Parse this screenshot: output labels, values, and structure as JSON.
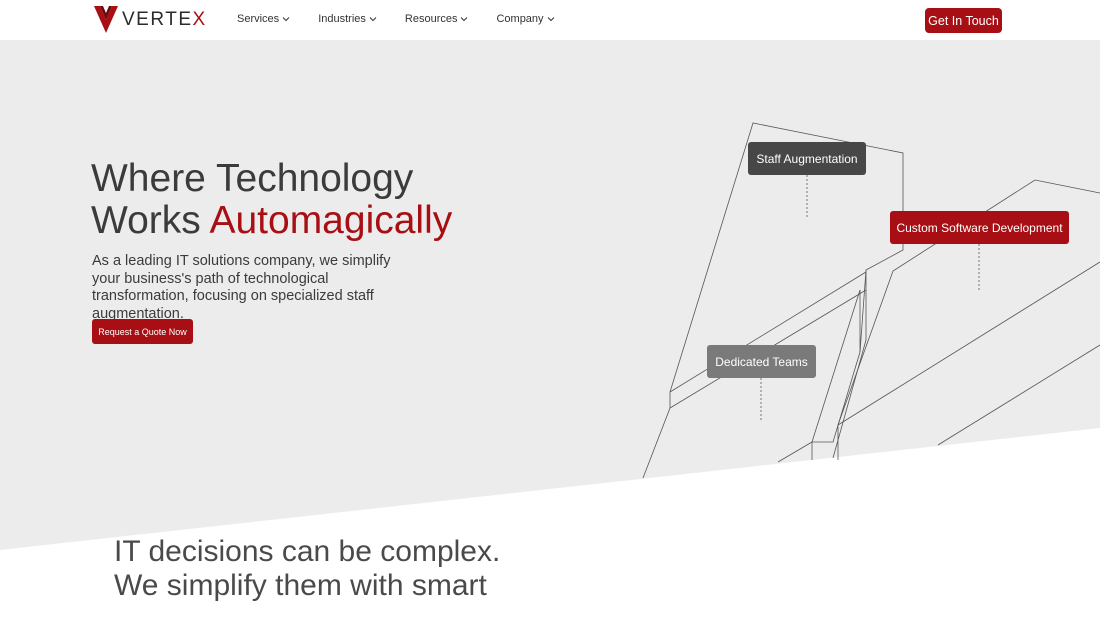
{
  "header": {
    "logo": {
      "text_main": "VERTE",
      "text_accent": "X",
      "icon": "vertex-v-logo-icon",
      "brand_color": "#a80f14"
    },
    "nav": [
      {
        "label": "Services",
        "icon": "chevron-down-icon"
      },
      {
        "label": "Industries",
        "icon": "chevron-down-icon"
      },
      {
        "label": "Resources",
        "icon": "chevron-down-icon"
      },
      {
        "label": "Company",
        "icon": "chevron-down-icon"
      }
    ],
    "cta_label": "Get In Touch"
  },
  "hero": {
    "headline_line1": "Where Technology",
    "headline_line2_plain": "Works ",
    "headline_line2_accent": "Automagically",
    "subtext": "As a leading IT solutions company, we simplify your business's path of technological transformation, focusing on specialized staff augmentation.",
    "quote_button": "Request a Quote Now",
    "tags": {
      "staff": "Staff Augmentation",
      "custom": "Custom Software Development",
      "teams": "Dedicated Teams"
    },
    "background_color": "#ececec",
    "accent_color": "#a80f14"
  },
  "section": {
    "line1": "IT decisions can be complex.",
    "line2": "We simplify them with smart"
  }
}
